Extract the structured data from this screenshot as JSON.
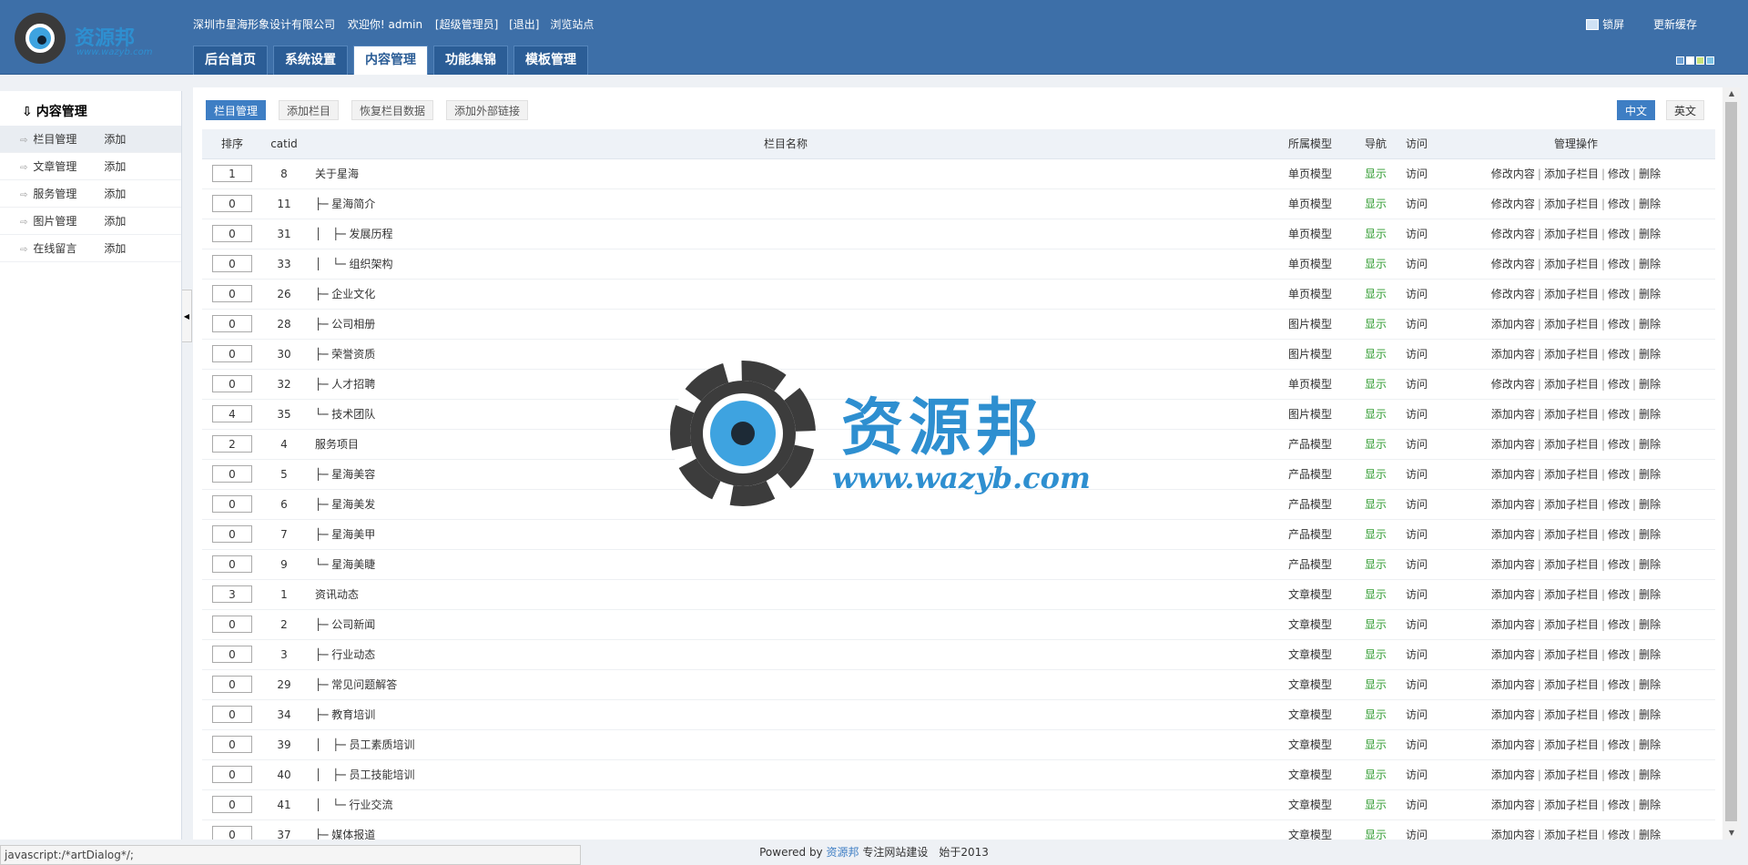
{
  "header": {
    "logo_text": "资源邦",
    "logo_url": "www.wazyb.com",
    "company": "深圳市星海形象设计有限公司",
    "welcome": "欢迎你! admin",
    "role": "[超级管理员]",
    "logout": "[退出]",
    "browse": "浏览站点",
    "lock": "锁屏",
    "refresh_cache": "更新缓存",
    "skins": [
      "#6fa3d8",
      "#ffffff",
      "#c7e37a",
      "#7cc3e6"
    ]
  },
  "nav": {
    "tabs": [
      "后台首页",
      "系统设置",
      "内容管理",
      "功能集锦",
      "模板管理"
    ],
    "active": "内容管理"
  },
  "sidebar": {
    "title": "内容管理",
    "items": [
      {
        "label": "栏目管理",
        "add": "添加"
      },
      {
        "label": "文章管理",
        "add": "添加"
      },
      {
        "label": "服务管理",
        "add": "添加"
      },
      {
        "label": "图片管理",
        "add": "添加"
      },
      {
        "label": "在线留言",
        "add": "添加"
      }
    ]
  },
  "subnav": {
    "buttons": [
      "栏目管理",
      "添加栏目",
      "恢复栏目数据",
      "添加外部链接"
    ],
    "lang": [
      "中文",
      "英文"
    ]
  },
  "table": {
    "headers": {
      "order": "排序",
      "catid": "catid",
      "name": "栏目名称",
      "model": "所属模型",
      "nav": "导航",
      "visit": "访问",
      "ops": "管理操作"
    },
    "rows": [
      {
        "order": "1",
        "catid": "8",
        "name": "关于星海",
        "model": "单页模型",
        "nav": "显示",
        "visit": "访问",
        "ops": [
          "修改内容",
          "添加子栏目",
          "修改",
          "删除"
        ]
      },
      {
        "order": "0",
        "catid": "11",
        "name": "├─ 星海简介",
        "model": "单页模型",
        "nav": "显示",
        "visit": "访问",
        "ops": [
          "修改内容",
          "添加子栏目",
          "修改",
          "删除"
        ]
      },
      {
        "order": "0",
        "catid": "31",
        "name": "│　├─ 发展历程",
        "model": "单页模型",
        "nav": "显示",
        "visit": "访问",
        "ops": [
          "修改内容",
          "添加子栏目",
          "修改",
          "删除"
        ]
      },
      {
        "order": "0",
        "catid": "33",
        "name": "│　└─ 组织架构",
        "model": "单页模型",
        "nav": "显示",
        "visit": "访问",
        "ops": [
          "修改内容",
          "添加子栏目",
          "修改",
          "删除"
        ]
      },
      {
        "order": "0",
        "catid": "26",
        "name": "├─ 企业文化",
        "model": "单页模型",
        "nav": "显示",
        "visit": "访问",
        "ops": [
          "修改内容",
          "添加子栏目",
          "修改",
          "删除"
        ]
      },
      {
        "order": "0",
        "catid": "28",
        "name": "├─ 公司相册",
        "model": "图片模型",
        "nav": "显示",
        "visit": "访问",
        "ops": [
          "添加内容",
          "添加子栏目",
          "修改",
          "删除"
        ]
      },
      {
        "order": "0",
        "catid": "30",
        "name": "├─ 荣誉资质",
        "model": "图片模型",
        "nav": "显示",
        "visit": "访问",
        "ops": [
          "添加内容",
          "添加子栏目",
          "修改",
          "删除"
        ]
      },
      {
        "order": "0",
        "catid": "32",
        "name": "├─ 人才招聘",
        "model": "单页模型",
        "nav": "显示",
        "visit": "访问",
        "ops": [
          "修改内容",
          "添加子栏目",
          "修改",
          "删除"
        ]
      },
      {
        "order": "4",
        "catid": "35",
        "name": "└─ 技术团队",
        "model": "图片模型",
        "nav": "显示",
        "visit": "访问",
        "ops": [
          "添加内容",
          "添加子栏目",
          "修改",
          "删除"
        ]
      },
      {
        "order": "2",
        "catid": "4",
        "name": "服务项目",
        "model": "产品模型",
        "nav": "显示",
        "visit": "访问",
        "ops": [
          "添加内容",
          "添加子栏目",
          "修改",
          "删除"
        ]
      },
      {
        "order": "0",
        "catid": "5",
        "name": "├─ 星海美容",
        "model": "产品模型",
        "nav": "显示",
        "visit": "访问",
        "ops": [
          "添加内容",
          "添加子栏目",
          "修改",
          "删除"
        ]
      },
      {
        "order": "0",
        "catid": "6",
        "name": "├─ 星海美发",
        "model": "产品模型",
        "nav": "显示",
        "visit": "访问",
        "ops": [
          "添加内容",
          "添加子栏目",
          "修改",
          "删除"
        ]
      },
      {
        "order": "0",
        "catid": "7",
        "name": "├─ 星海美甲",
        "model": "产品模型",
        "nav": "显示",
        "visit": "访问",
        "ops": [
          "添加内容",
          "添加子栏目",
          "修改",
          "删除"
        ]
      },
      {
        "order": "0",
        "catid": "9",
        "name": "└─ 星海美睫",
        "model": "产品模型",
        "nav": "显示",
        "visit": "访问",
        "ops": [
          "添加内容",
          "添加子栏目",
          "修改",
          "删除"
        ]
      },
      {
        "order": "3",
        "catid": "1",
        "name": "资讯动态",
        "model": "文章模型",
        "nav": "显示",
        "visit": "访问",
        "ops": [
          "添加内容",
          "添加子栏目",
          "修改",
          "删除"
        ]
      },
      {
        "order": "0",
        "catid": "2",
        "name": "├─ 公司新闻",
        "model": "文章模型",
        "nav": "显示",
        "visit": "访问",
        "ops": [
          "添加内容",
          "添加子栏目",
          "修改",
          "删除"
        ]
      },
      {
        "order": "0",
        "catid": "3",
        "name": "├─ 行业动态",
        "model": "文章模型",
        "nav": "显示",
        "visit": "访问",
        "ops": [
          "添加内容",
          "添加子栏目",
          "修改",
          "删除"
        ]
      },
      {
        "order": "0",
        "catid": "29",
        "name": "├─ 常见问题解答",
        "model": "文章模型",
        "nav": "显示",
        "visit": "访问",
        "ops": [
          "添加内容",
          "添加子栏目",
          "修改",
          "删除"
        ]
      },
      {
        "order": "0",
        "catid": "34",
        "name": "├─ 教育培训",
        "model": "文章模型",
        "nav": "显示",
        "visit": "访问",
        "ops": [
          "添加内容",
          "添加子栏目",
          "修改",
          "删除"
        ]
      },
      {
        "order": "0",
        "catid": "39",
        "name": "│　├─ 员工素质培训",
        "model": "文章模型",
        "nav": "显示",
        "visit": "访问",
        "ops": [
          "添加内容",
          "添加子栏目",
          "修改",
          "删除"
        ]
      },
      {
        "order": "0",
        "catid": "40",
        "name": "│　├─ 员工技能培训",
        "model": "文章模型",
        "nav": "显示",
        "visit": "访问",
        "ops": [
          "添加内容",
          "添加子栏目",
          "修改",
          "删除"
        ]
      },
      {
        "order": "0",
        "catid": "41",
        "name": "│　└─ 行业交流",
        "model": "文章模型",
        "nav": "显示",
        "visit": "访问",
        "ops": [
          "添加内容",
          "添加子栏目",
          "修改",
          "删除"
        ]
      },
      {
        "order": "0",
        "catid": "37",
        "name": "├─ 媒体报道",
        "model": "文章模型",
        "nav": "显示",
        "visit": "访问",
        "ops": [
          "添加内容",
          "添加子栏目",
          "修改",
          "删除"
        ]
      }
    ]
  },
  "footer": {
    "powered": "Powered by",
    "brand": "资源邦",
    "slogan": "专注网站建设　始于2013"
  },
  "statusbar": "javascript:/*artDialog*/;",
  "watermark": {
    "name": "资源邦",
    "url": "www.wazyb.com"
  }
}
